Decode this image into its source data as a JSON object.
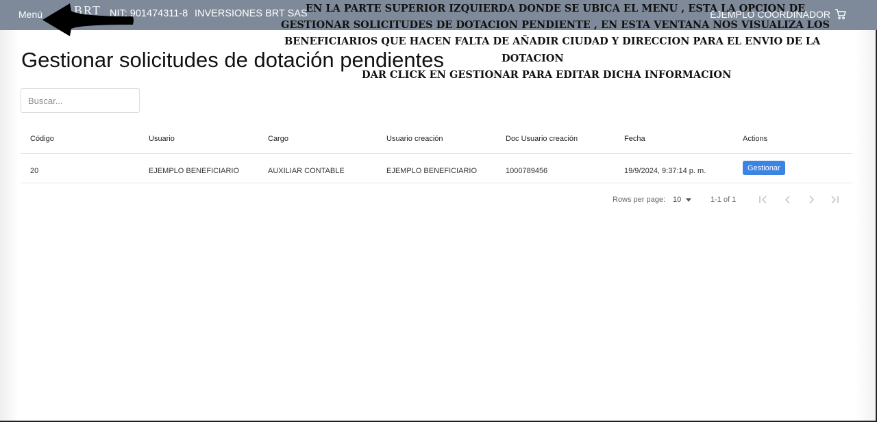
{
  "navbar": {
    "menu_label": "Menú",
    "logo_text": "BRT",
    "nit": "NIT: 901474311-8",
    "company": "INVERSIONES BRT SAS",
    "user": "EJEMPLO COORDINADOR",
    "cart_icon": "cart-icon",
    "background": "#7e8a99"
  },
  "annotations": {
    "line1": "EN LA PARTE SUPERIOR IZQUIERDA DONDE SE UBICA EL MENU , ESTA LA OPCION DE",
    "line2": "GESTIONAR SOLICITUDES DE DOTACION PENDIENTE , EN ESTA VENTANA NOS VISUALIZA LOS",
    "line3": "BENEFICIARIOS QUE HACEN FALTA  DE AÑADIR CIUDAD Y DIRECCION PARA EL ENVIO DE LA",
    "line4": "DOTACION",
    "line5": "DAR CLICK EN GESTIONAR PARA EDITAR DICHA INFORMACION"
  },
  "page": {
    "title": "Gestionar solicitudes de dotación pendientes"
  },
  "search": {
    "placeholder": "Buscar...",
    "value": ""
  },
  "table": {
    "columns": [
      "Código",
      "Usuario",
      "Cargo",
      "Usuario creación",
      "Doc Usuario creación",
      "Fecha",
      "Actions"
    ],
    "rows": [
      {
        "codigo": "20",
        "usuario": "EJEMPLO BENEFICIARIO",
        "cargo": "AUXILIAR CONTABLE",
        "usuario_creacion": "EJEMPLO BENEFICIARIO",
        "doc_usuario_creacion": "1000789456",
        "fecha": "19/9/2024, 9:37:14 p. m.",
        "action_label": "Gestionar"
      }
    ]
  },
  "pagination": {
    "rows_per_page_label": "Rows per page:",
    "rows_per_page_value": "10",
    "range": "1-1 of 1",
    "icons": [
      "first-page-icon",
      "prev-page-icon",
      "next-page-icon",
      "last-page-icon"
    ]
  },
  "colors": {
    "accent_button": "#3c84e4",
    "arrow": "#000000"
  }
}
